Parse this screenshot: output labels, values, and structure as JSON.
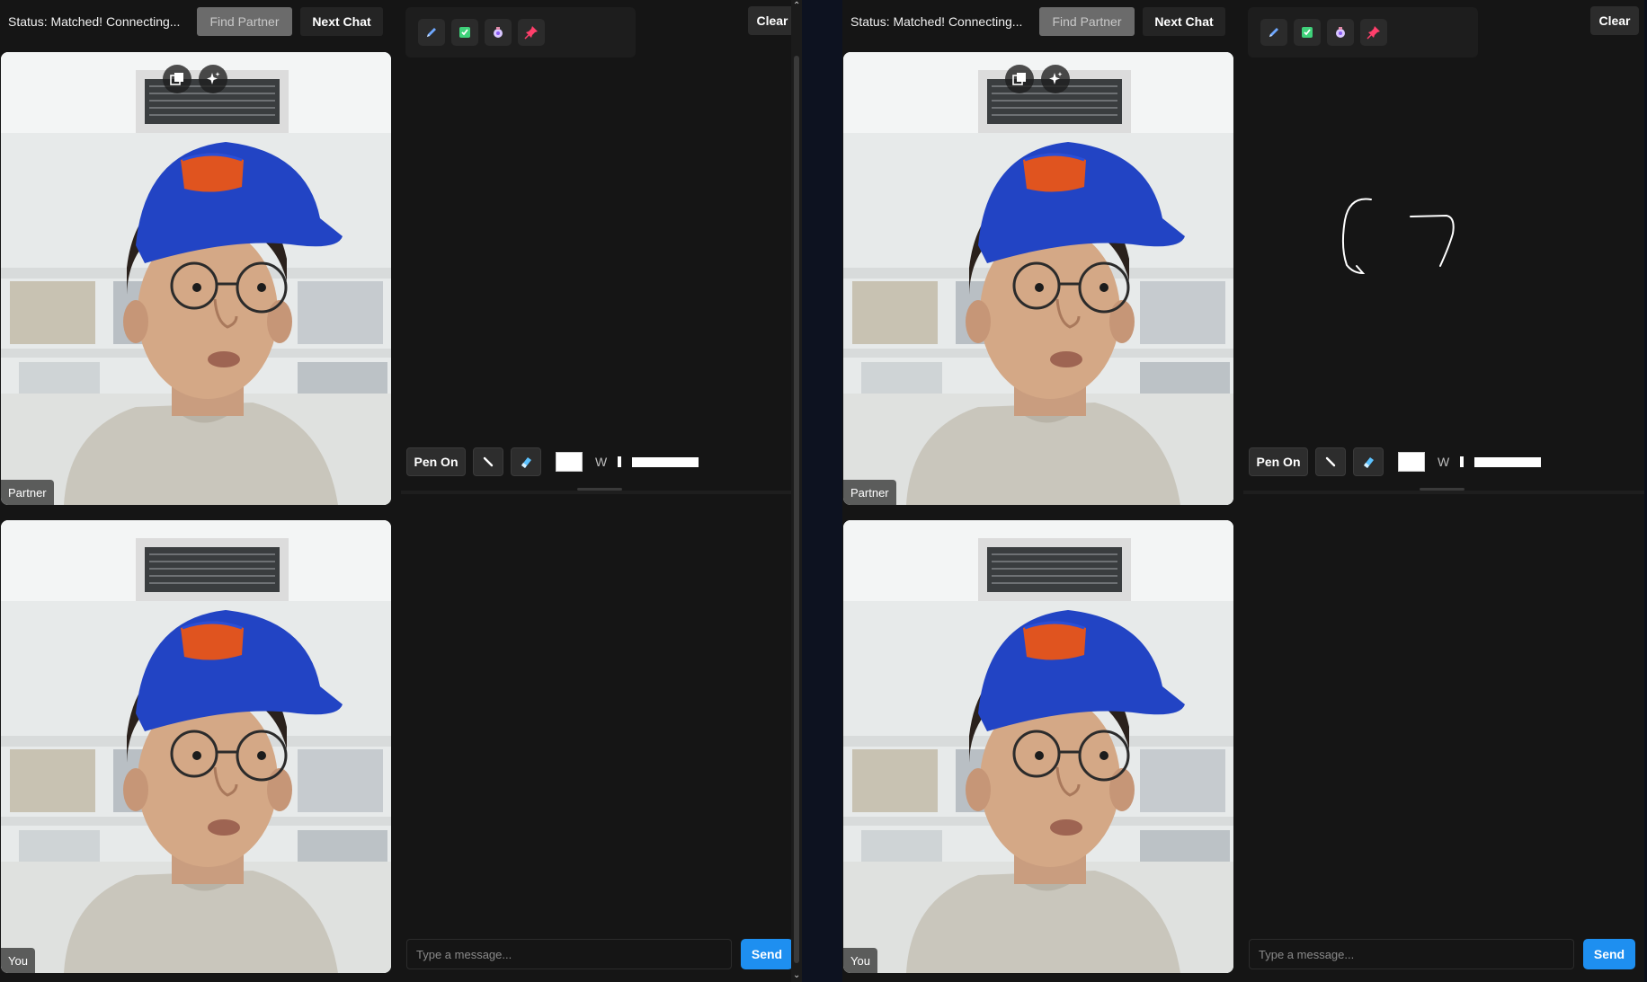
{
  "windows": [
    {
      "status": "Status: Matched! Connecting...",
      "find_partner": "Find Partner",
      "next_chat": "Next Chat",
      "clear": "Clear",
      "partner_label": "Partner",
      "you_label": "You",
      "pen_on": "Pen On",
      "width_label": "W",
      "message_placeholder": "Type a message...",
      "send": "Send"
    },
    {
      "status": "Status: Matched! Connecting...",
      "find_partner": "Find Partner",
      "next_chat": "Next Chat",
      "clear": "Clear",
      "partner_label": "Partner",
      "you_label": "You",
      "pen_on": "Pen On",
      "width_label": "W",
      "message_placeholder": "Type a message...",
      "send": "Send"
    }
  ],
  "icons": {
    "tools": [
      "pen-icon",
      "highlight-icon",
      "stamp-icon",
      "pin-icon"
    ],
    "video_overlay": [
      "picture-in-picture-icon",
      "sparkle-effects-icon"
    ],
    "pen_bar": [
      "pencil-icon",
      "eraser-icon"
    ]
  },
  "colors": {
    "send_button": "#1e8ff0",
    "pen_color": "#ffffff",
    "find_partner_disabled": "#6b6b6b"
  }
}
